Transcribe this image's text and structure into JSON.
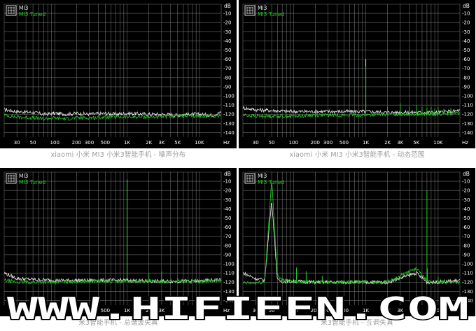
{
  "legend": {
    "items": [
      "MI3",
      "MI3 Tuned"
    ]
  },
  "axes": {
    "y_unit": "dB",
    "y_ticks": [
      "-10",
      "-20",
      "-30",
      "-40",
      "-50",
      "-60",
      "-70",
      "-80",
      "-90",
      "-100",
      "-110",
      "-120",
      "-130",
      "-140"
    ],
    "x_unit": "Hz",
    "x_ticks": [
      "30",
      "50",
      "100",
      "200",
      "300",
      "500",
      "1K",
      "2K",
      "3K",
      "5K",
      "10K"
    ]
  },
  "colors": {
    "background": "#000000",
    "grid": "#6e6e6e",
    "mi3": "#e8e8e8",
    "tuned": "#22cc22",
    "text": "#ffffff",
    "caption": "#9a9a9a"
  },
  "panels": [
    {
      "caption": "xiaomi 小米 MI3 小米3智能手机 - 噪声分布"
    },
    {
      "caption": "xiaomi 小米 MI3 小米3智能手机 - 动态范围"
    },
    {
      "caption": "米3智能手机 - 总谐波失真"
    },
    {
      "caption": "米3智能手机 - 互调失真"
    }
  ],
  "watermark": {
    "text": "WWW.HIFIEEN.COM"
  },
  "chart_data": [
    {
      "type": "line",
      "title": "",
      "xlabel": "Hz",
      "ylabel": "dB",
      "xscale": "log",
      "xlim": [
        20,
        20000
      ],
      "ylim": [
        -145,
        0
      ],
      "grid": true,
      "legend": "top-left",
      "series": [
        {
          "name": "MI3",
          "x": [
            20,
            30,
            50,
            70,
            100,
            150,
            200,
            300,
            500,
            700,
            1000,
            2000,
            3000,
            5000,
            7000,
            10000,
            15000,
            20000
          ],
          "values": [
            -115,
            -117,
            -118,
            -120,
            -119,
            -120,
            -119,
            -120,
            -119,
            -120,
            -119,
            -120,
            -120,
            -121,
            -120,
            -120,
            -121,
            -118
          ]
        },
        {
          "name": "MI3 Tuned",
          "x": [
            20,
            30,
            50,
            70,
            100,
            150,
            200,
            300,
            500,
            700,
            1000,
            2000,
            3000,
            5000,
            7000,
            10000,
            15000,
            20000
          ],
          "values": [
            -121,
            -123,
            -124,
            -125,
            -124,
            -125,
            -124,
            -124,
            -123,
            -123,
            -123,
            -123,
            -123,
            -122,
            -122,
            -122,
            -122,
            -121
          ]
        }
      ]
    },
    {
      "type": "line",
      "title": "",
      "xlabel": "Hz",
      "ylabel": "dB",
      "xscale": "log",
      "xlim": [
        20,
        20000
      ],
      "ylim": [
        -145,
        0
      ],
      "grid": true,
      "legend": "top-left",
      "series": [
        {
          "name": "MI3",
          "x": [
            20,
            30,
            50,
            100,
            200,
            500,
            1000,
            2000,
            5000,
            10000,
            20000
          ],
          "values": [
            -113,
            -115,
            -116,
            -117,
            -117,
            -117,
            -117,
            -118,
            -118,
            -118,
            -116
          ],
          "peaks": [
            [
              1000,
              -60
            ]
          ]
        },
        {
          "name": "MI3 Tuned",
          "x": [
            20,
            30,
            50,
            100,
            200,
            500,
            1000,
            2000,
            5000,
            10000,
            20000
          ],
          "values": [
            -121,
            -122,
            -122,
            -122,
            -121,
            -121,
            -121,
            -120,
            -120,
            -120,
            -119
          ],
          "peaks": [
            [
              1000,
              -68
            ],
            [
              2000,
              -112
            ],
            [
              3000,
              -108
            ],
            [
              4000,
              -112
            ],
            [
              5000,
              -110
            ],
            [
              6000,
              -112
            ],
            [
              7000,
              -113
            ],
            [
              8000,
              -112
            ],
            [
              9000,
              -114
            ],
            [
              10000,
              -112
            ],
            [
              12000,
              -114
            ],
            [
              15000,
              -113
            ]
          ]
        }
      ]
    },
    {
      "type": "line",
      "title": "",
      "xlabel": "Hz",
      "ylabel": "dB",
      "xscale": "log",
      "xlim": [
        20,
        20000
      ],
      "ylim": [
        -145,
        0
      ],
      "grid": true,
      "legend": "top-left",
      "series": [
        {
          "name": "MI3",
          "x": [
            20,
            30,
            50,
            100,
            200,
            500,
            1000,
            2000,
            5000,
            10000,
            20000
          ],
          "values": [
            -110,
            -116,
            -117,
            -118,
            -118,
            -118,
            -118,
            -119,
            -119,
            -119,
            -117
          ],
          "peaks": [
            [
              1000,
              -8
            ]
          ]
        },
        {
          "name": "MI3 Tuned",
          "x": [
            20,
            30,
            50,
            100,
            200,
            500,
            1000,
            2000,
            5000,
            10000,
            20000
          ],
          "values": [
            -118,
            -120,
            -120,
            -120,
            -119,
            -119,
            -119,
            -119,
            -119,
            -119,
            -118
          ],
          "peaks": [
            [
              1000,
              -8
            ],
            [
              2000,
              -110
            ],
            [
              3000,
              -108
            ],
            [
              5000,
              -115
            ],
            [
              10000,
              -116
            ]
          ]
        }
      ]
    },
    {
      "type": "line",
      "title": "",
      "xlabel": "Hz",
      "ylabel": "dB",
      "xscale": "log",
      "xlim": [
        20,
        20000
      ],
      "ylim": [
        -145,
        0
      ],
      "grid": true,
      "legend": "top-left",
      "series": [
        {
          "name": "MI3",
          "x": [
            20,
            30,
            40,
            50,
            60,
            70,
            100,
            200,
            500,
            1000,
            2000,
            5000,
            7000,
            10000,
            20000
          ],
          "values": [
            -110,
            -116,
            -118,
            -30,
            -118,
            -119,
            -119,
            -120,
            -120,
            -120,
            -120,
            -110,
            -120,
            -120,
            -118
          ]
        },
        {
          "name": "MI3 Tuned",
          "x": [
            20,
            30,
            40,
            50,
            60,
            70,
            100,
            200,
            500,
            1000,
            2000,
            5000,
            7000,
            10000,
            20000
          ],
          "values": [
            -121,
            -121,
            -120,
            -8,
            -112,
            -118,
            -119,
            -120,
            -120,
            -120,
            -120,
            -105,
            -119,
            -120,
            -120
          ],
          "peaks": [
            [
              110,
              -104
            ],
            [
              150,
              -108
            ],
            [
              250,
              -113
            ],
            [
              7000,
              -20
            ],
            [
              7100,
              -105
            ],
            [
              10000,
              -114
            ]
          ]
        }
      ]
    }
  ]
}
